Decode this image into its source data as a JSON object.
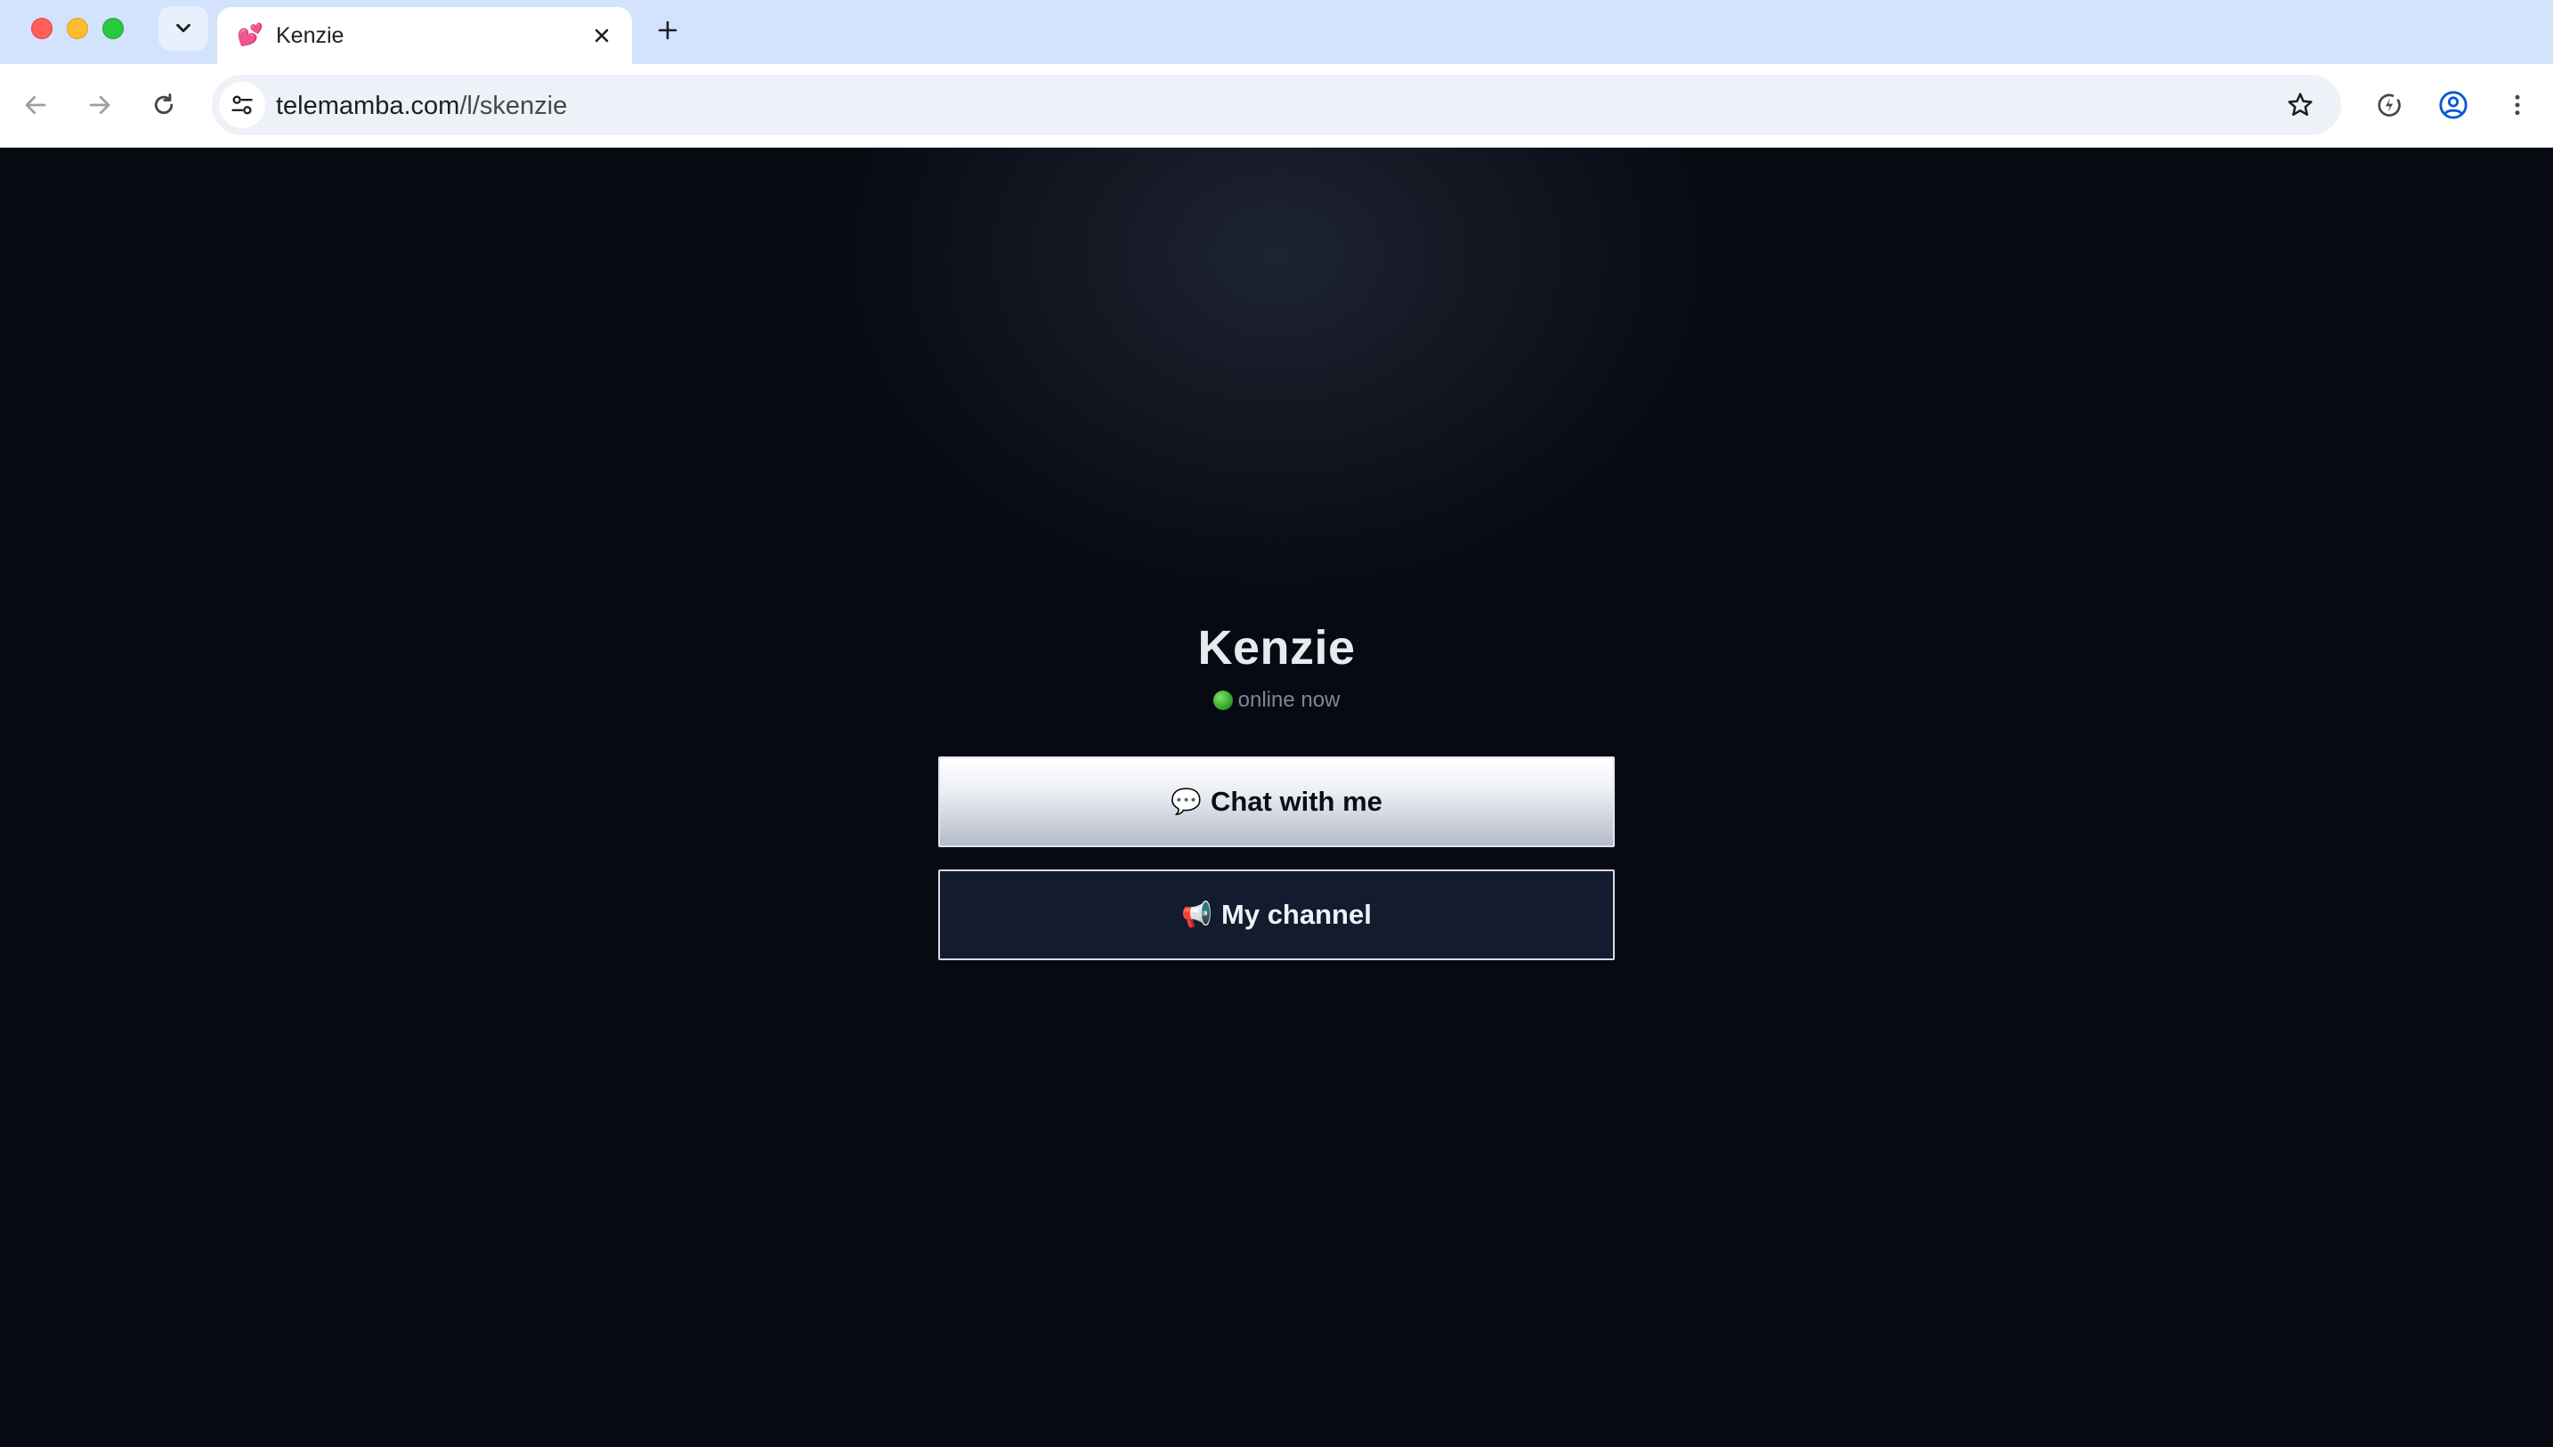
{
  "browser": {
    "tab": {
      "title": "Kenzie",
      "favicon": "💕"
    },
    "address": {
      "host": "telemamba.com",
      "path": "/l/skenzie"
    }
  },
  "profile": {
    "name": "Kenzie",
    "status_text": "online now",
    "status_color": "#3fb532"
  },
  "buttons": {
    "chat": {
      "icon": "💬",
      "label": "Chat with me"
    },
    "channel": {
      "icon": "📢",
      "label": "My channel"
    }
  },
  "colors": {
    "page_bg": "#070a12",
    "tabbar_bg": "#d3e3fd",
    "channel_button_bg": "#131b2e"
  }
}
